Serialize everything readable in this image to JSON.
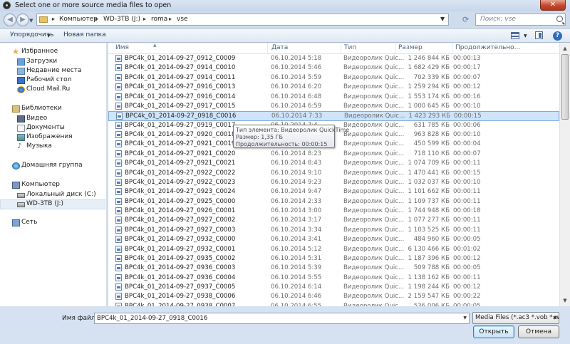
{
  "window": {
    "title": "Select one or more source media files to open",
    "close_label": "✕"
  },
  "address": {
    "crumbs": [
      "Компьютер",
      "WD-3TB (J:)",
      "roma",
      "vse"
    ]
  },
  "search": {
    "placeholder": "Поиск: vse"
  },
  "toolbar": {
    "organize_label": "Упорядочить",
    "new_folder_label": "Новая папка"
  },
  "navigation": {
    "favorites": {
      "label": "Избранное",
      "items": [
        "Загрузки",
        "Недавние места",
        "Рабочий стол",
        "Cloud Mail.Ru"
      ]
    },
    "libraries": {
      "label": "Библиотеки",
      "items": [
        "Видео",
        "Документы",
        "Изображения",
        "Музыка"
      ]
    },
    "homegroup": {
      "label": "Домашняя группа"
    },
    "computer": {
      "label": "Компьютер",
      "items": [
        "Локальный диск (C:)",
        "WD-3TB (J:)"
      ]
    },
    "network": {
      "label": "Сеть"
    }
  },
  "columns": {
    "name": "Имя",
    "date": "Дата",
    "type": "Тип",
    "size": "Размер",
    "duration": "Продолжительно..."
  },
  "files": [
    {
      "name": "BPC4k_01_2014-09-27_0912_C0009",
      "date": "06.10.2014 5:18",
      "type": "Видеоролик Quic...",
      "size": "1 246 844 КБ",
      "duration": "00:00:13"
    },
    {
      "name": "BPC4k_01_2014-09-27_0914_C0010",
      "date": "06.10.2014 5:46",
      "type": "Видеоролик Quic...",
      "size": "1 682 429 КБ",
      "duration": "00:00:17"
    },
    {
      "name": "BPC4k_01_2014-09-27_0914_C0011",
      "date": "06.10.2014 5:59",
      "type": "Видеоролик Quic...",
      "size": "702 339 КБ",
      "duration": "00:00:07"
    },
    {
      "name": "BPC4k_01_2014-09-27_0916_C0013",
      "date": "06.10.2014 6:20",
      "type": "Видеоролик Quic...",
      "size": "1 259 294 КБ",
      "duration": "00:00:12"
    },
    {
      "name": "BPC4k_01_2014-09-27_0916_C0014",
      "date": "06.10.2014 6:48",
      "type": "Видеоролик Quic...",
      "size": "1 553 174 КБ",
      "duration": "00:00:16"
    },
    {
      "name": "BPC4k_01_2014-09-27_0917_C0015",
      "date": "06.10.2014 6:59",
      "type": "Видеоролик Quic...",
      "size": "1 000 645 КБ",
      "duration": "00:00:10"
    },
    {
      "name": "BPC4k_01_2014-09-27_0918_C0016",
      "date": "06.10.2014 7:33",
      "type": "Видеоролик Quic...",
      "size": "1 423 293 КБ",
      "duration": "00:00:15"
    },
    {
      "name": "BPC4k_01_2014-09-27_0919_C0017",
      "date": "06.10.2014 7:4",
      "type": "Видеоролик Quic...",
      "size": "631 785 КБ",
      "duration": "00:00:06"
    },
    {
      "name": "BPC4k_01_2014-09-27_0920_C0018",
      "date": "06.10.2014 7:4",
      "type": "Видеоролик Quic...",
      "size": "963 828 КБ",
      "duration": "00:00:10"
    },
    {
      "name": "BPC4k_01_2014-09-27_0921_C0019",
      "date": "06.10.2014 7:5",
      "type": "Видеоролик Quic...",
      "size": "450 599 КБ",
      "duration": "00:00:04"
    },
    {
      "name": "BPC4k_01_2014-09-27_0921_C0020",
      "date": "06.10.2014 8:23",
      "type": "Видеоролик Quic...",
      "size": "718 110 КБ",
      "duration": "00:00:07"
    },
    {
      "name": "BPC4k_01_2014-09-27_0921_C0021",
      "date": "06.10.2014 8:43",
      "type": "Видеоролик Quic...",
      "size": "1 074 709 КБ",
      "duration": "00:00:11"
    },
    {
      "name": "BPC4k_01_2014-09-27_0922_C0022",
      "date": "06.10.2014 9:10",
      "type": "Видеоролик Quic...",
      "size": "1 470 441 КБ",
      "duration": "00:00:15"
    },
    {
      "name": "BPC4k_01_2014-09-27_0922_C0023",
      "date": "06.10.2014 9:23",
      "type": "Видеоролик Quic...",
      "size": "1 032 037 КБ",
      "duration": "00:00:10"
    },
    {
      "name": "BPC4k_01_2014-09-27_0923_C0024",
      "date": "06.10.2014 9:47",
      "type": "Видеоролик Quic...",
      "size": "1 101 662 КБ",
      "duration": "00:00:11"
    },
    {
      "name": "BPC4k_01_2014-09-27_0925_C0000",
      "date": "06.10.2014 2:33",
      "type": "Видеоролик Quic...",
      "size": "1 109 737 КБ",
      "duration": "00:00:11"
    },
    {
      "name": "BPC4k_01_2014-09-27_0926_C0001",
      "date": "06.10.2014 3:00",
      "type": "Видеоролик Quic...",
      "size": "1 744 948 КБ",
      "duration": "00:00:18"
    },
    {
      "name": "BPC4k_01_2014-09-27_0927_C0002",
      "date": "06.10.2014 3:17",
      "type": "Видеоролик Quic...",
      "size": "1 077 277 КБ",
      "duration": "00:00:11"
    },
    {
      "name": "BPC4k_01_2014-09-27_0927_C0003",
      "date": "06.10.2014 3:34",
      "type": "Видеоролик Quic...",
      "size": "1 103 525 КБ",
      "duration": "00:00:11"
    },
    {
      "name": "BPC4k_01_2014-09-27_0932_C0000",
      "date": "06.10.2014 3:41",
      "type": "Видеоролик Quic...",
      "size": "484 960 КБ",
      "duration": "00:00:05"
    },
    {
      "name": "BPC4k_01_2014-09-27_0932_C0001",
      "date": "06.10.2014 5:12",
      "type": "Видеоролик Quic...",
      "size": "6 130 466 КБ",
      "duration": "00:01:02"
    },
    {
      "name": "BPC4k_01_2014-09-27_0935_C0002",
      "date": "06.10.2014 5:31",
      "type": "Видеоролик Quic...",
      "size": "1 187 396 КБ",
      "duration": "00:00:12"
    },
    {
      "name": "BPC4k_01_2014-09-27_0936_C0003",
      "date": "06.10.2014 5:39",
      "type": "Видеоролик Quic...",
      "size": "509 788 КБ",
      "duration": "00:00:05"
    },
    {
      "name": "BPC4k_01_2014-09-27_0936_C0004",
      "date": "06.10.2014 5:55",
      "type": "Видеоролик Quic...",
      "size": "1 138 162 КБ",
      "duration": "00:00:11"
    },
    {
      "name": "BPC4k_01_2014-09-27_0937_C0005",
      "date": "06.10.2014 6:14",
      "type": "Видеоролик Quic...",
      "size": "1 198 244 КБ",
      "duration": "00:00:12"
    },
    {
      "name": "BPC4k_01_2014-09-27_0938_C0006",
      "date": "06.10.2014 6:46",
      "type": "Видеоролик Quic...",
      "size": "2 159 547 КБ",
      "duration": "00:00:22"
    },
    {
      "name": "BPC4k_01_2014-09-27_0938_C0007",
      "date": "06.10.2014 6:55",
      "type": "Видеоролик Quic...",
      "size": "536 006 КБ",
      "duration": "00:00:05"
    }
  ],
  "selected_index": 6,
  "tooltip": {
    "type": "Тип элемента: Видеоролик QuickTime",
    "size": "Размер: 1,35 ГБ",
    "duration": "Продолжительность: 00:00:15"
  },
  "filename": {
    "label": "Имя файла:",
    "value": "BPC4k_01_2014-09-27_0918_C0016"
  },
  "filter": {
    "value": "Media Files (*.ac3 *.vob *.wmv"
  },
  "buttons": {
    "open": "Открыть",
    "cancel": "Отмена"
  }
}
